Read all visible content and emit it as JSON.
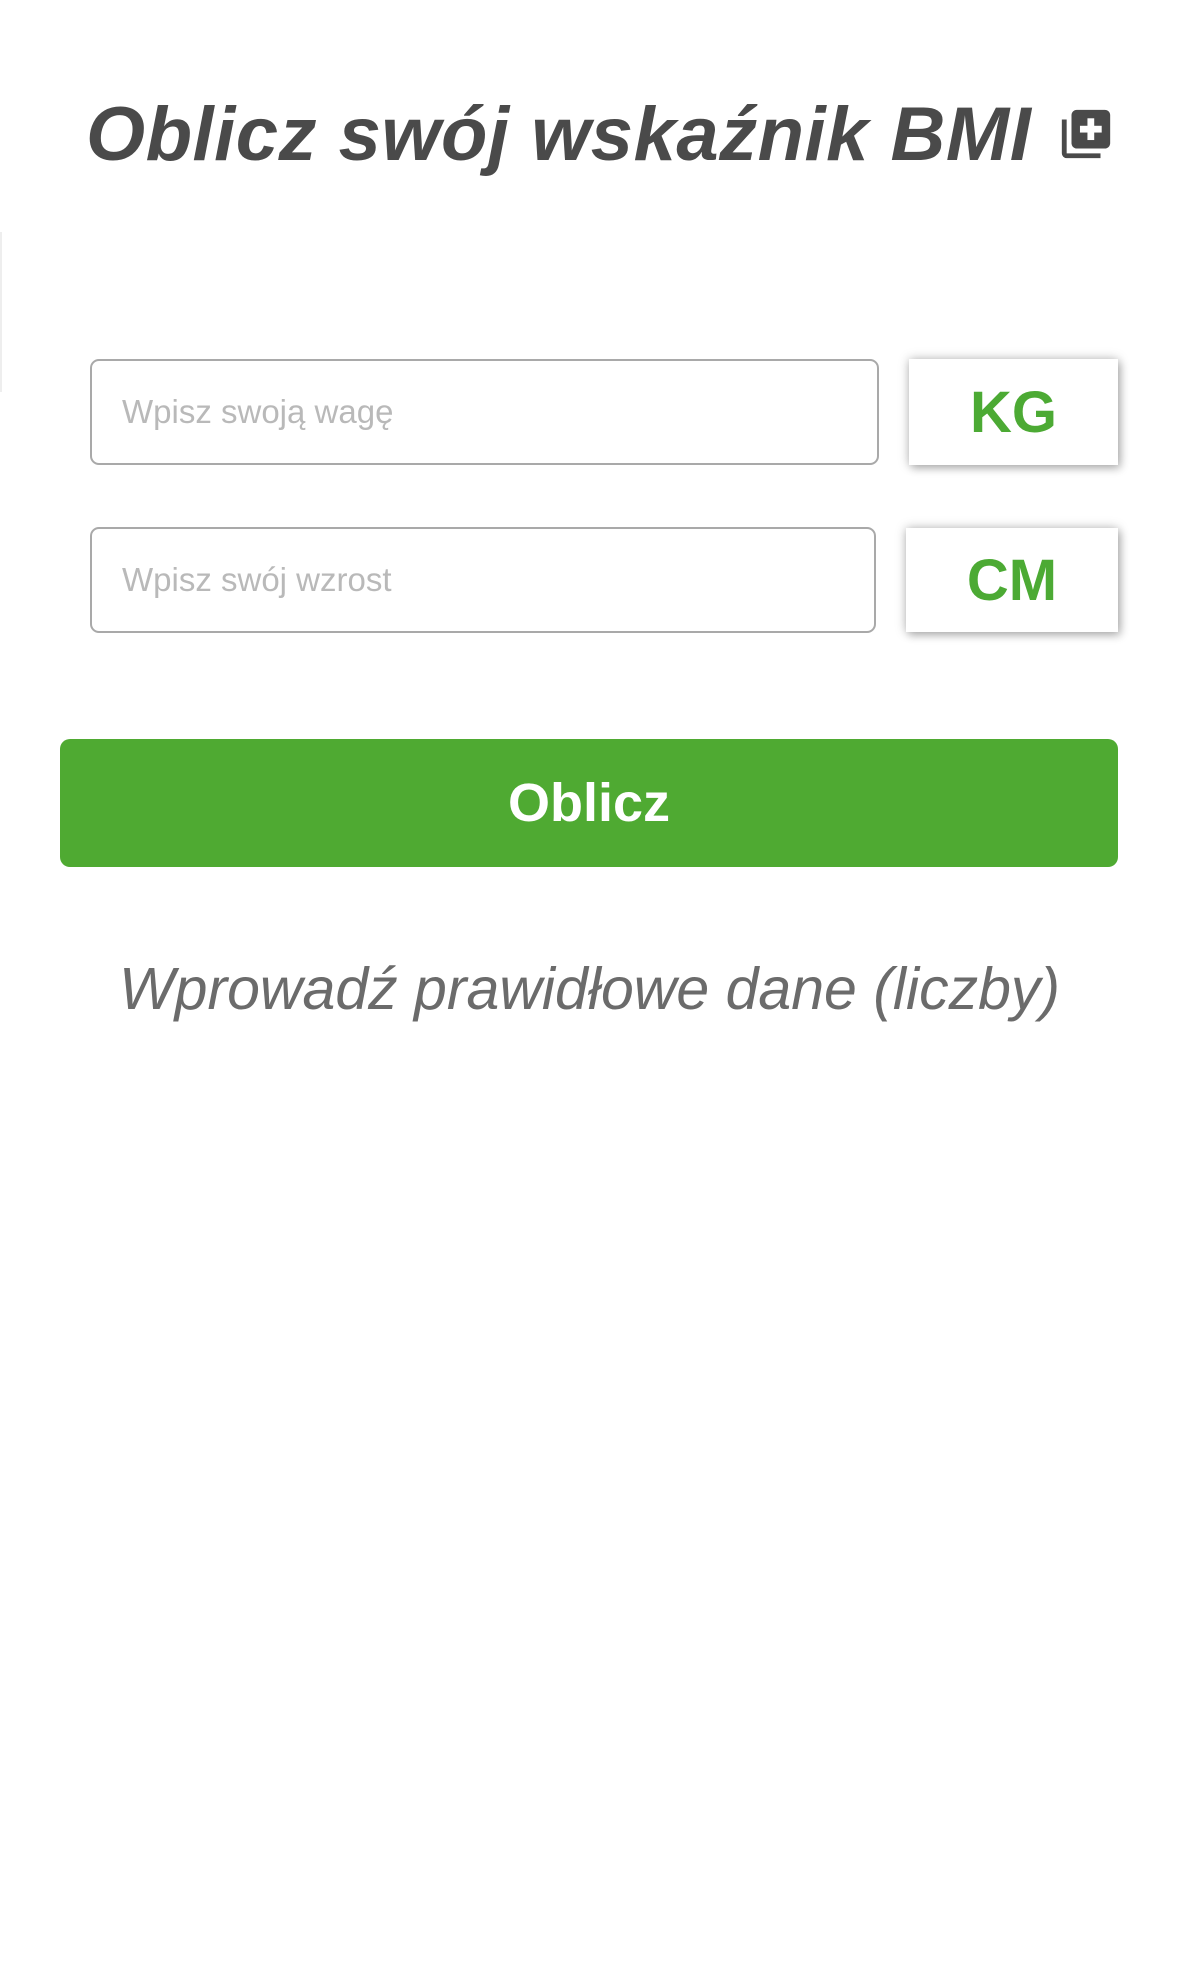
{
  "header": {
    "title": "Oblicz swój wskaźnik BMI",
    "icon": "medical-plus-copy-icon"
  },
  "form": {
    "weight": {
      "placeholder": "Wpisz swoją wagę",
      "value": "",
      "unit_label": "KG"
    },
    "height": {
      "placeholder": "Wpisz swój wzrost",
      "value": "",
      "unit_label": "CM"
    },
    "submit_label": "Oblicz"
  },
  "result": {
    "message": "Wprowadź prawidłowe dane (liczby)"
  },
  "colors": {
    "accent_green": "#4faa32",
    "title_gray": "#4a4a4a",
    "message_gray": "#6b6b6b",
    "border_gray": "#a9a9a9"
  }
}
